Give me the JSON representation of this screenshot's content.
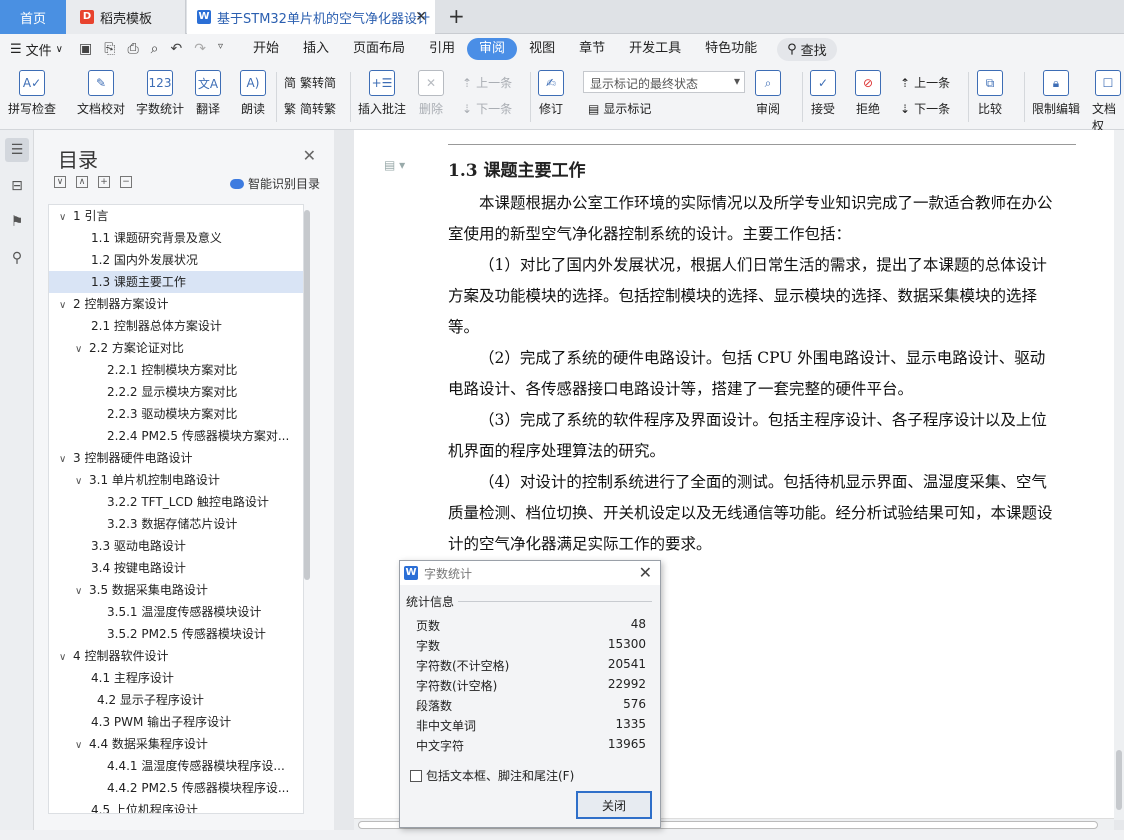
{
  "tabs": {
    "home": "首页",
    "template": "稻壳模板",
    "doc": "基于STM32单片机的空气净化器设计"
  },
  "menu": {
    "file": "文件",
    "items": [
      "开始",
      "插入",
      "页面布局",
      "引用",
      "审阅",
      "视图",
      "章节",
      "开发工具",
      "特色功能"
    ],
    "active": "审阅",
    "search": "查找"
  },
  "ribbon": {
    "spell": "拼写检查",
    "proof": "文档校对",
    "count": "字数统计",
    "translate": "翻译",
    "read": "朗读",
    "trad": "繁转简",
    "simp": "简转繁",
    "insert_comment": "插入批注",
    "delete": "删除",
    "prev_comment": "上一条",
    "next_comment": "下一条",
    "revise": "修订",
    "show_mode": "显示标记的最终状态",
    "show_marks": "显示标记",
    "review": "审阅",
    "accept": "接受",
    "reject": "拒绝",
    "prev": "上一条",
    "next": "下一条",
    "compare": "比较",
    "restrict": "限制编辑",
    "doc_perm": "文档权"
  },
  "toc": {
    "title": "目录",
    "smart": "智能识别目录",
    "items": [
      {
        "text": "1   引言",
        "toggle": "∨"
      },
      {
        "text": "1.1   课题研究背景及意义",
        "toggle": ""
      },
      {
        "text": "1.2   国内外发展状况",
        "toggle": ""
      },
      {
        "text": "1.3   课题主要工作",
        "toggle": ""
      },
      {
        "text": "2   控制器方案设计",
        "toggle": "∨"
      },
      {
        "text": "2.1   控制器总体方案设计",
        "toggle": ""
      },
      {
        "text": "2.2   方案论证对比",
        "toggle": "∨"
      },
      {
        "text": "2.2.1   控制模块方案对比",
        "toggle": ""
      },
      {
        "text": "2.2.2   显示模块方案对比",
        "toggle": ""
      },
      {
        "text": "2.2.3   驱动模块方案对比",
        "toggle": ""
      },
      {
        "text": "2.2.4   PM2.5 传感器模块方案对...",
        "toggle": ""
      },
      {
        "text": "3   控制器硬件电路设计",
        "toggle": "∨"
      },
      {
        "text": "3.1   单片机控制电路设计",
        "toggle": "∨"
      },
      {
        "text": "3.2.2   TFT_LCD 触控电路设计",
        "toggle": ""
      },
      {
        "text": "3.2.3   数据存储芯片设计",
        "toggle": ""
      },
      {
        "text": "3.3   驱动电路设计",
        "toggle": ""
      },
      {
        "text": "3.4   按键电路设计",
        "toggle": ""
      },
      {
        "text": "3.5   数据采集电路设计",
        "toggle": "∨"
      },
      {
        "text": "3.5.1   温湿度传感器模块设计",
        "toggle": ""
      },
      {
        "text": "3.5.2   PM2.5 传感器模块设计",
        "toggle": ""
      },
      {
        "text": "4   控制器软件设计",
        "toggle": "∨"
      },
      {
        "text": "4.1   主程序设计",
        "toggle": ""
      },
      {
        "text": "4.2   显示子程序设计",
        "toggle": ""
      },
      {
        "text": "4.3   PWM 输出子程序设计",
        "toggle": ""
      },
      {
        "text": "4.4   数据采集程序设计",
        "toggle": "∨"
      },
      {
        "text": "4.4.1   温湿度传感器模块程序设...",
        "toggle": ""
      },
      {
        "text": "4.4.2   PM2.5 传感器模块程序设...",
        "toggle": ""
      },
      {
        "text": "4.5   上位机程序设计",
        "toggle": ""
      }
    ]
  },
  "document": {
    "heading": "1.3    课题主要工作",
    "paragraphs": [
      "本课题根据办公室工作环境的实际情况以及所学专业知识完成了一款适合教师在办公室使用的新型空气净化器控制系统的设计。主要工作包括：",
      "（1）对比了国内外发展状况，根据人们日常生活的需求，提出了本课题的总体设计方案及功能模块的选择。包括控制模块的选择、显示模块的选择、数据采集模块的选择等。",
      "（2）完成了系统的硬件电路设计。包括 CPU 外围电路设计、显示电路设计、驱动电路设计、各传感器接口电路设计等，搭建了一套完整的硬件平台。",
      "（3）完成了系统的软件程序及界面设计。包括主程序设计、各子程序设计以及上位机界面的程序处理算法的研究。",
      "（4）对设计的控制系统进行了全面的测试。包括待机显示界面、温湿度采集、空气质量检测、档位切换、开关机设定以及无线通信等功能。经分析试验结果可知，本课题设计的空气净化器满足实际工作的要求。"
    ]
  },
  "dialog": {
    "title": "字数统计",
    "section": "统计信息",
    "rows": [
      {
        "label": "页数",
        "value": "48"
      },
      {
        "label": "字数",
        "value": "15300"
      },
      {
        "label": "字符数(不计空格)",
        "value": "20541"
      },
      {
        "label": "字符数(计空格)",
        "value": "22992"
      },
      {
        "label": "段落数",
        "value": "576"
      },
      {
        "label": "非中文单词",
        "value": "1335"
      },
      {
        "label": "中文字符",
        "value": "13965"
      }
    ],
    "checkbox": "包括文本框、脚注和尾注(F)",
    "close": "关闭"
  }
}
